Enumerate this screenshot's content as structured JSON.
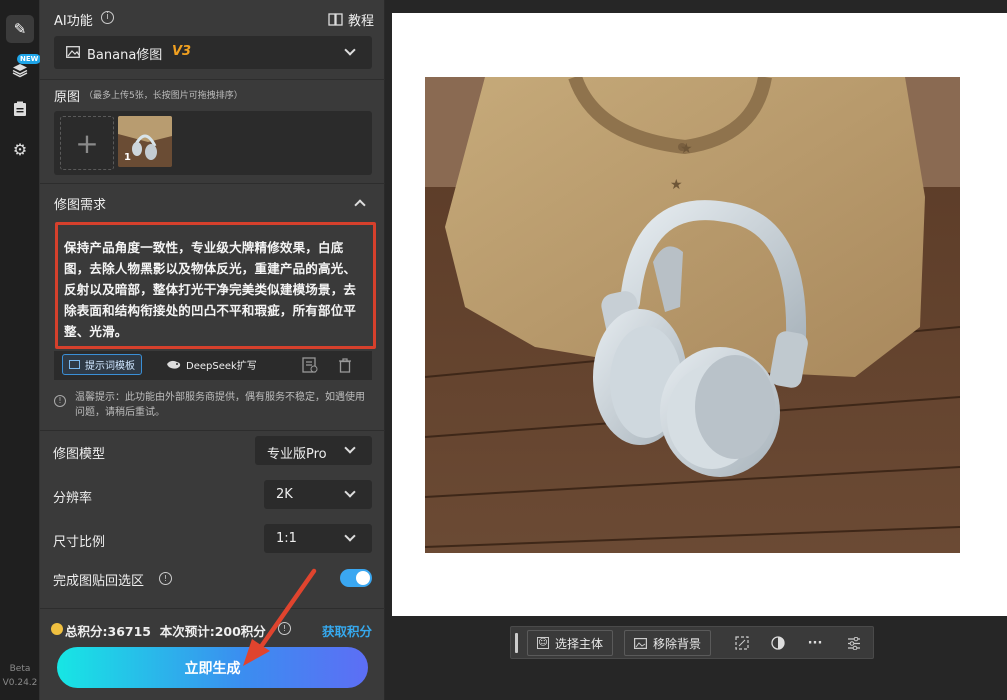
{
  "rail": {
    "new_badge": "NEW",
    "beta": "Beta",
    "version": "V0.24.2"
  },
  "panel": {
    "ai_feature_label": "AI功能",
    "tutorial_label": "教程",
    "model_select": {
      "name": "Banana修图",
      "tag": "V3"
    },
    "source": {
      "title": "原图",
      "hint": "（最多上传5张，长按图片可拖拽排序）",
      "add_symbol": "+",
      "thumb_index": "1"
    },
    "requirement": {
      "title": "修图需求",
      "text": "保持产品角度一致性，专业级大牌精修效果，白底图，去除人物黑影以及物体反光，重建产品的高光、反射以及暗部，整体打光干净完美类似建模场景，去除表面和结构衔接处的凹凸不平和瑕疵，所有部位平整、光滑。",
      "template_btn": "提示词模板",
      "deepseek_btn": "DeepSeek扩写"
    },
    "notice": "温馨提示：此功能由外部服务商提供，偶有服务不稳定，如遇使用问题，请稍后重试。",
    "model": {
      "label": "修图模型",
      "value": "专业版Pro"
    },
    "resolution": {
      "label": "分辨率",
      "value": "2K"
    },
    "ratio": {
      "label": "尺寸比例",
      "value": "1:1"
    },
    "paste_back": {
      "label": "完成图贴回选区",
      "enabled": true
    },
    "credits": {
      "text": "总积分:36715  本次预计:200积分",
      "get_link": "获取积分"
    },
    "generate_btn": "立即生成"
  },
  "toolbar": {
    "select_subject": "选择主体",
    "remove_bg": "移除背景",
    "more": "···"
  },
  "colors": {
    "accent": "#3aa7f1",
    "highlight_border": "#d6402c",
    "arrow": "#e0442e",
    "gold": "#f0c040"
  }
}
